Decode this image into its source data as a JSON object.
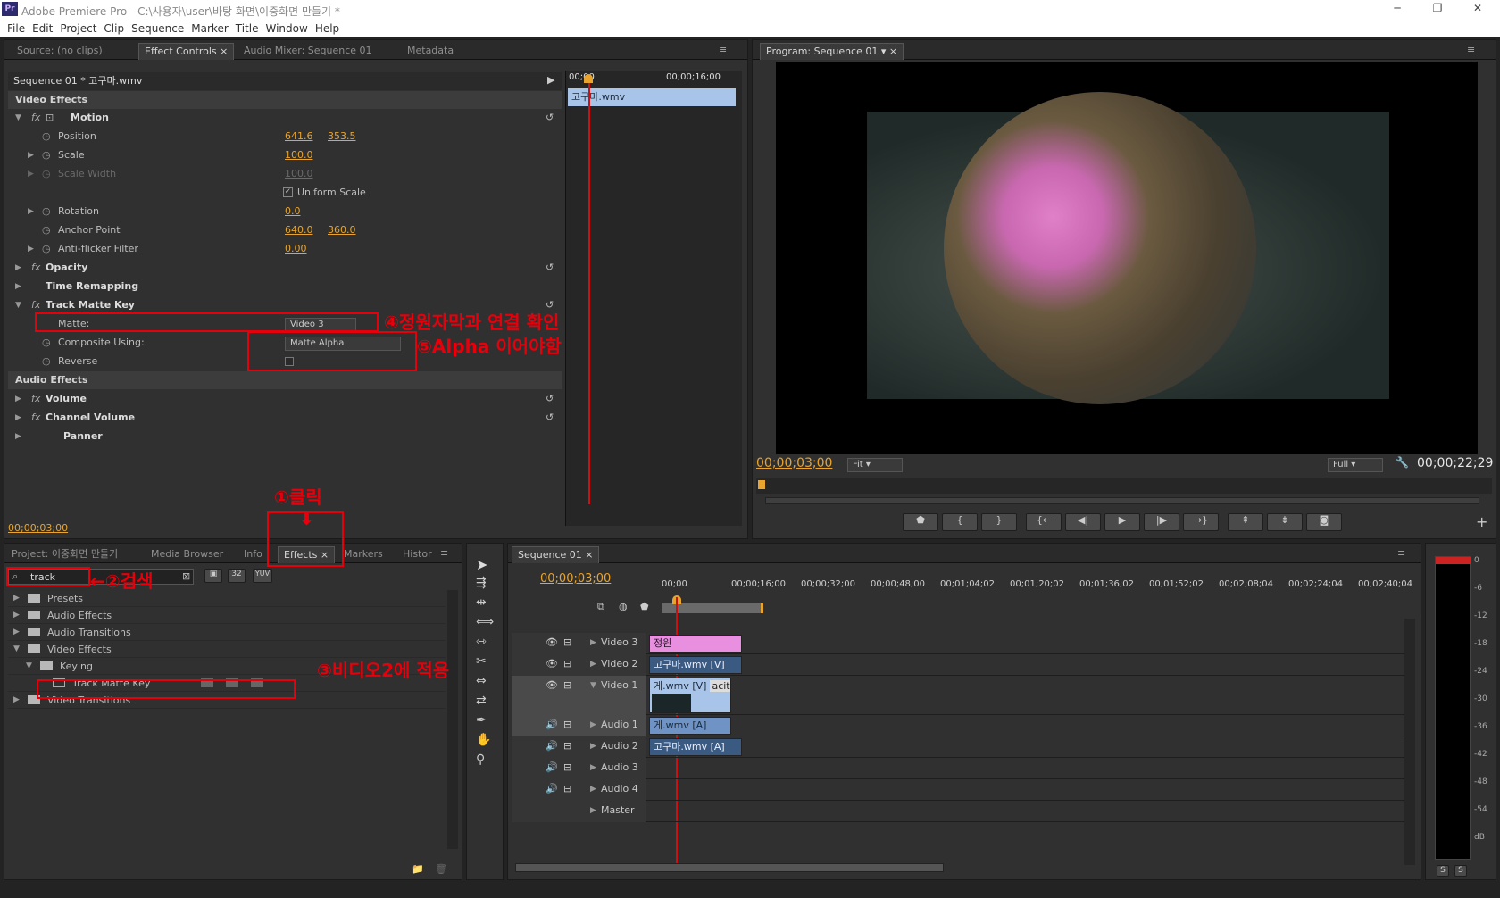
{
  "app": {
    "title": "Adobe Premiere Pro - C:\\사용자\\user\\바탕 화면\\이중화면 만들기 *",
    "logo": "Pr"
  },
  "menu": [
    "File",
    "Edit",
    "Project",
    "Clip",
    "Sequence",
    "Marker",
    "Title",
    "Window",
    "Help"
  ],
  "effect_panel": {
    "tabs": [
      "Source: (no clips)",
      "Effect Controls",
      "Audio Mixer: Sequence 01",
      "Metadata"
    ],
    "header": "Sequence 01 * 고구마.wmv",
    "ruler_start": "00;00",
    "ruler_mid": "00;00;16;00",
    "clip_label": "고구마.wmv",
    "video_effects": "Video Effects",
    "motion": "Motion",
    "position_label": "Position",
    "position_x": "641.6",
    "position_y": "353.5",
    "scale_label": "Scale",
    "scale_val": "100.0",
    "scalew_label": "Scale Width",
    "scalew_val": "100.0",
    "uniform_label": "Uniform Scale",
    "rotation_label": "Rotation",
    "rotation_val": "0.0",
    "anchor_label": "Anchor Point",
    "anchor_x": "640.0",
    "anchor_y": "360.0",
    "flicker_label": "Anti-flicker Filter",
    "flicker_val": "0.00",
    "opacity": "Opacity",
    "timeremap": "Time Remapping",
    "trackmatte": "Track Matte Key",
    "matte_label": "Matte:",
    "matte_val": "Video 3",
    "composite_label": "Composite Using:",
    "composite_val": "Matte Alpha",
    "reverse_label": "Reverse",
    "audio_effects": "Audio Effects",
    "volume": "Volume",
    "channelvol": "Channel Volume",
    "panner": "Panner",
    "timecode": "00;00;03;00"
  },
  "annotations": {
    "a1": "①클릭",
    "a2": "←②검색",
    "a3": "③비디오2에 적용",
    "a4": "④정원자막과 연결 확인",
    "a5": "⑤Alpha 이어야함"
  },
  "program": {
    "tab": "Program: Sequence 01",
    "timecode": "00;00;03;00",
    "fit": "Fit",
    "full": "Full",
    "duration": "00;00;22;29"
  },
  "project_panel": {
    "tabs": [
      "Project: 이중화면 만들기",
      "Media Browser",
      "Info",
      "Effects",
      "Markers",
      "Histor"
    ],
    "search_value": "track",
    "icon_labels": [
      "32",
      "YUV"
    ],
    "items": [
      {
        "label": "Presets",
        "level": 0,
        "open": false
      },
      {
        "label": "Audio Effects",
        "level": 0,
        "open": false
      },
      {
        "label": "Audio Transitions",
        "level": 0,
        "open": false
      },
      {
        "label": "Video Effects",
        "level": 0,
        "open": true
      },
      {
        "label": "Keying",
        "level": 1,
        "open": true
      },
      {
        "label": "Track Matte Key",
        "level": 2,
        "open": false
      },
      {
        "label": "Video Transitions",
        "level": 0,
        "open": false
      }
    ]
  },
  "timeline": {
    "tab": "Sequence 01",
    "timecode": "00;00;03;00",
    "ruler": [
      "00;00",
      "00;00;16;00",
      "00;00;32;00",
      "00;00;48;00",
      "00;01;04;02",
      "00;01;20;02",
      "00;01;36;02",
      "00;01;52;02",
      "00;02;08;04",
      "00;02;24;04",
      "00;02;40;04"
    ],
    "tracks": [
      {
        "name": "Video 3",
        "clip": "정원"
      },
      {
        "name": "Video 2",
        "clip": "고구마.wmv [V]"
      },
      {
        "name": "Video 1",
        "clip": "게.wmv [V]",
        "extra": "acity"
      },
      {
        "name": "Audio 1",
        "clip": "게.wmv [A]"
      },
      {
        "name": "Audio 2",
        "clip": "고구마.wmv [A]"
      },
      {
        "name": "Audio 3",
        "clip": ""
      },
      {
        "name": "Audio 4",
        "clip": ""
      },
      {
        "name": "Master",
        "clip": ""
      }
    ]
  },
  "meter": {
    "labels": [
      "0",
      "-6",
      "-12",
      "-18",
      "-24",
      "-30",
      "-36",
      "-42",
      "-48",
      "-54",
      "dB"
    ],
    "solo": [
      "S",
      "S"
    ]
  },
  "colors": {
    "accent": "#e8a42c",
    "annotation": "#e5000b",
    "video_clip": "#a8c4e8",
    "title_clip": "#e88fe0"
  }
}
